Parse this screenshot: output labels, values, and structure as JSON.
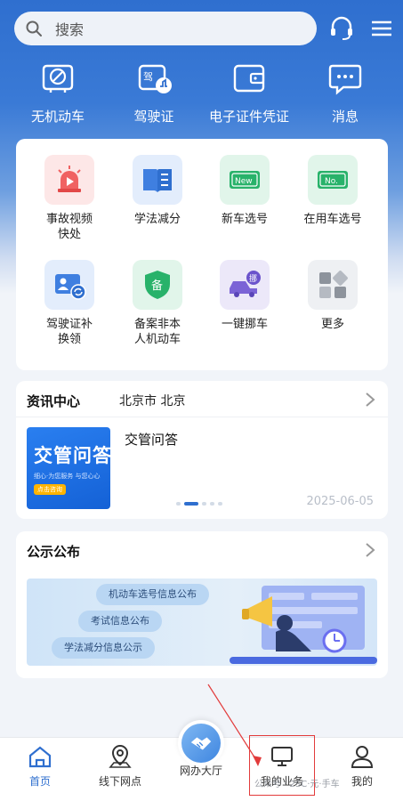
{
  "search": {
    "placeholder": "搜索"
  },
  "top_shortcuts": [
    {
      "label": "无机动车",
      "icon": "no-vehicle-icon"
    },
    {
      "label": "驾驶证",
      "icon": "driver-license-icon"
    },
    {
      "label": "电子证件凭证",
      "icon": "wallet-icon"
    },
    {
      "label": "消息",
      "icon": "message-icon"
    }
  ],
  "services": [
    {
      "label": "事故视频\n快处",
      "icon": "alarm-video-icon",
      "tile_color": "#fde7e7"
    },
    {
      "label": "学法减分",
      "icon": "book-icon",
      "tile_color": "#e3edfc"
    },
    {
      "label": "新车选号",
      "icon": "new-plate-icon",
      "tile_color": "#e1f5ea"
    },
    {
      "label": "在用车选号",
      "icon": "plate-no-icon",
      "tile_color": "#e1f5ea"
    },
    {
      "label": "驾驶证补\n换领",
      "icon": "license-renew-icon",
      "tile_color": "#e3edfc"
    },
    {
      "label": "备案非本\n人机动车",
      "icon": "shield-record-icon",
      "tile_color": "#e1f5ea"
    },
    {
      "label": "一键挪车",
      "icon": "move-car-icon",
      "tile_color": "#ece8f9"
    },
    {
      "label": "更多",
      "icon": "more-grid-icon",
      "tile_color": "#eef0f3"
    }
  ],
  "news": {
    "heading": "资讯中心",
    "city": "北京市 北京",
    "item_title": "交管问答",
    "thumb_title": "交管问答",
    "thumb_sub": "细心·为您服务  与您心心",
    "thumb_button": "点击咨询",
    "date": "2025-06-05"
  },
  "notice": {
    "heading": "公示公布",
    "pills": [
      "机动车选号信息公布",
      "考试信息公布",
      "学法减分信息公示"
    ]
  },
  "tabs": [
    {
      "label": "首页",
      "icon": "home-icon",
      "active": true
    },
    {
      "label": "线下网点",
      "icon": "location-pin-icon",
      "active": false
    },
    {
      "label": "网办大厅",
      "icon": "handshake-icon",
      "active": false
    },
    {
      "label": "我的业务",
      "icon": "monitor-icon",
      "active": false
    },
    {
      "label": "我的",
      "icon": "user-icon",
      "active": false
    }
  ],
  "watermark": "公众号 · 2SC·元·手车",
  "colors": {
    "primary": "#2f6fcf",
    "highlight": "#e23b3b"
  }
}
